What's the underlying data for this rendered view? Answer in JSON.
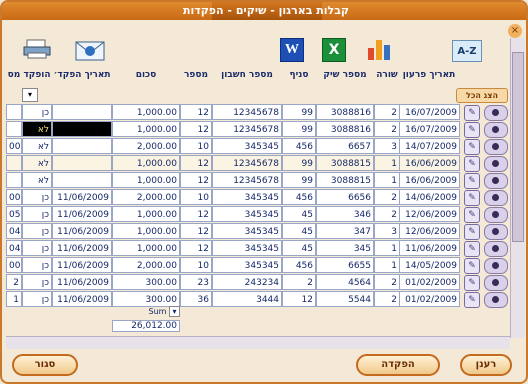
{
  "window": {
    "title": "קבלות בארגון - שיקים - הפקדות"
  },
  "toolbar": {
    "word_letter": "W",
    "excel_letter": "X",
    "sort_label": "A-Z"
  },
  "columns": [
    "תאריך פרעון",
    "שורה",
    "מספר שיק",
    "סניף",
    "מספר חשבון",
    "מספר",
    "סכום",
    "תאריך הפקד׳",
    "הופקד",
    "מס"
  ],
  "show_all_label": "הצג הכל",
  "rows": [
    {
      "date": "16/07/2009",
      "line": "2",
      "cheque": "3088816",
      "branch": "99",
      "account": "12345678",
      "num": "12",
      "amount": "1,000.00",
      "dep_date": "",
      "deposited": "כן",
      "bank": "",
      "alt": false
    },
    {
      "date": "16/07/2009",
      "line": "2",
      "cheque": "3088816",
      "branch": "99",
      "account": "12345678",
      "num": "12",
      "amount": "1,000.00",
      "dep_date": "",
      "deposited": "לא",
      "bank": "",
      "alt": false
    },
    {
      "date": "14/07/2009",
      "line": "3",
      "cheque": "6657",
      "branch": "456",
      "account": "345345",
      "num": "10",
      "amount": "2,000.00",
      "dep_date": "",
      "deposited": "לא",
      "bank": "00",
      "alt": false
    },
    {
      "date": "16/06/2009",
      "line": "1",
      "cheque": "3088815",
      "branch": "99",
      "account": "12345678",
      "num": "12",
      "amount": "1,000.00",
      "dep_date": "",
      "deposited": "לא",
      "bank": "",
      "alt": true
    },
    {
      "date": "16/06/2009",
      "line": "1",
      "cheque": "3088815",
      "branch": "99",
      "account": "12345678",
      "num": "12",
      "amount": "1,000.00",
      "dep_date": "",
      "deposited": "לא",
      "bank": "",
      "alt": false
    },
    {
      "date": "14/06/2009",
      "line": "2",
      "cheque": "6656",
      "branch": "456",
      "account": "345345",
      "num": "10",
      "amount": "2,000.00",
      "dep_date": "11/06/2009",
      "deposited": "כן",
      "bank": "00",
      "alt": false
    },
    {
      "date": "12/06/2009",
      "line": "2",
      "cheque": "346",
      "branch": "45",
      "account": "345345",
      "num": "12",
      "amount": "1,000.00",
      "dep_date": "11/06/2009",
      "deposited": "כן",
      "bank": "05",
      "alt": false
    },
    {
      "date": "12/06/2009",
      "line": "3",
      "cheque": "347",
      "branch": "45",
      "account": "345345",
      "num": "12",
      "amount": "1,000.00",
      "dep_date": "11/06/2009",
      "deposited": "כן",
      "bank": "04",
      "alt": false
    },
    {
      "date": "11/06/2009",
      "line": "1",
      "cheque": "345",
      "branch": "45",
      "account": "345345",
      "num": "12",
      "amount": "1,000.00",
      "dep_date": "11/06/2009",
      "deposited": "כן",
      "bank": "04",
      "alt": false
    },
    {
      "date": "14/05/2009",
      "line": "1",
      "cheque": "6655",
      "branch": "456",
      "account": "345345",
      "num": "10",
      "amount": "2,000.00",
      "dep_date": "11/06/2009",
      "deposited": "כן",
      "bank": "00",
      "alt": false
    },
    {
      "date": "01/02/2009",
      "line": "2",
      "cheque": "4564",
      "branch": "2",
      "account": "243234",
      "num": "23",
      "amount": "300.00",
      "dep_date": "11/06/2009",
      "deposited": "כן",
      "bank": "2",
      "alt": false
    },
    {
      "date": "01/02/2009",
      "line": "2",
      "cheque": "5544",
      "branch": "12",
      "account": "3444",
      "num": "36",
      "amount": "300.00",
      "dep_date": "11/06/2009",
      "deposited": "כן",
      "bank": "1",
      "alt": false
    }
  ],
  "footer": {
    "sum_label": "Sum",
    "sum_value": "26,012.00"
  },
  "buttons": {
    "refresh": "רענן",
    "deposit": "הפקדה",
    "close": "סגור"
  },
  "colors": {
    "accent": "#c9782c",
    "text": "#16286a",
    "selected_row": "#000000",
    "selected_text": "#f5e27a"
  }
}
